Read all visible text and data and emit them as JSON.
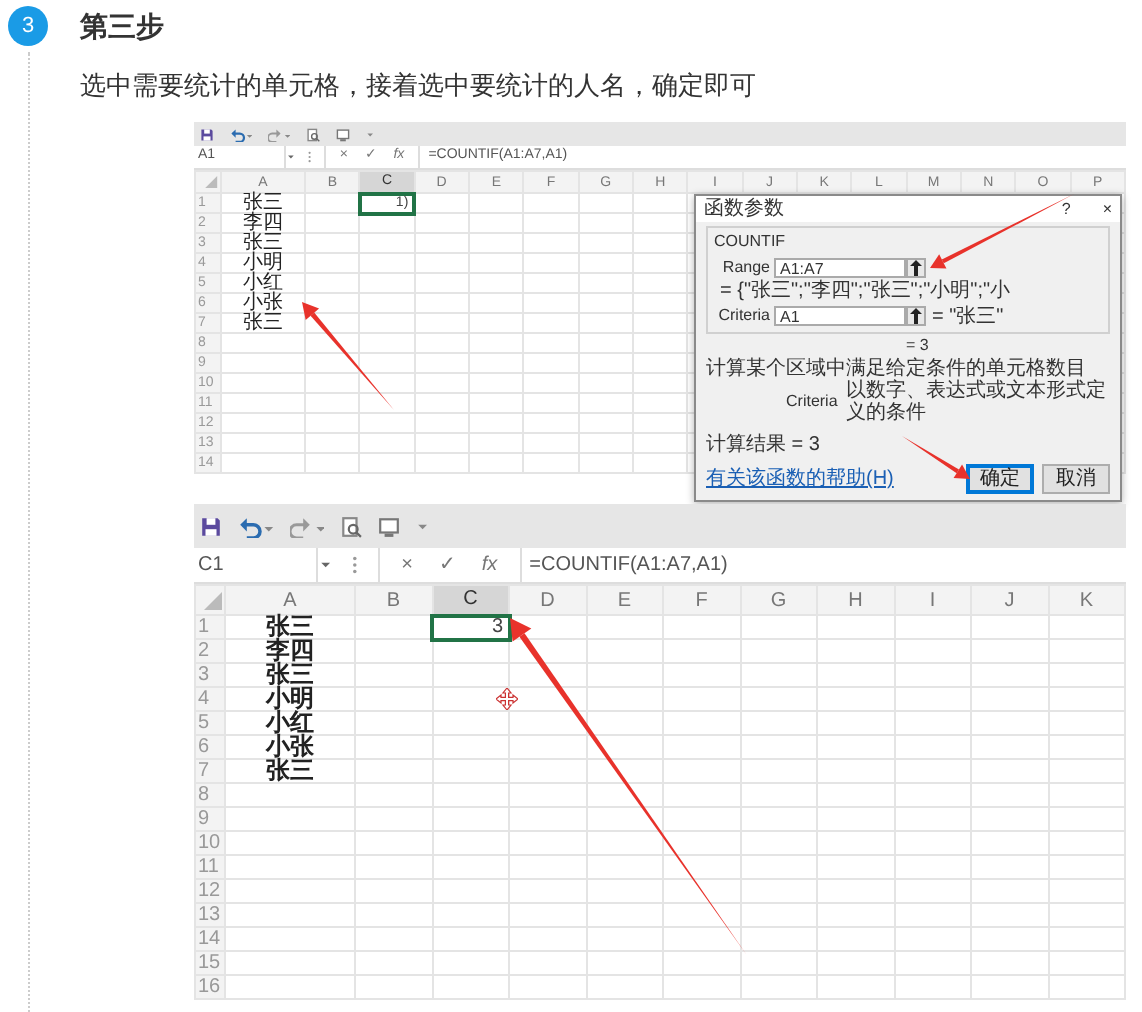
{
  "step": {
    "number": "3",
    "title": "第三步",
    "instruction": "选中需要统计的单元格，接着选中要统计的人名，确定即可"
  },
  "screenshots": [
    {
      "name_box": "A1",
      "formula_buttons": [
        "×",
        "✓",
        "fx"
      ],
      "formula": "=COUNTIF(A1:A7,A1)",
      "columns": [
        {
          "label": "A",
          "selected": false
        },
        {
          "label": "B",
          "selected": false
        },
        {
          "label": "C",
          "selected": true
        },
        {
          "label": "D",
          "selected": false
        },
        {
          "label": "E",
          "selected": false
        },
        {
          "label": "F",
          "selected": false
        },
        {
          "label": "G",
          "selected": false
        },
        {
          "label": "H",
          "selected": false
        },
        {
          "label": "I",
          "selected": false
        },
        {
          "label": "J",
          "selected": false
        },
        {
          "label": "K",
          "selected": false
        },
        {
          "label": "L",
          "selected": false
        },
        {
          "label": "M",
          "selected": false
        },
        {
          "label": "N",
          "selected": false
        },
        {
          "label": "O",
          "selected": false
        },
        {
          "label": "P",
          "selected": false
        }
      ],
      "rows": [
        {
          "number": "1",
          "column_a": "张三",
          "column_c": {
            "text": "1)",
            "selected": true
          }
        },
        {
          "number": "2",
          "column_a": "李四"
        },
        {
          "number": "3",
          "column_a": "张三"
        },
        {
          "number": "4",
          "column_a": "小明"
        },
        {
          "number": "5",
          "column_a": "小红"
        },
        {
          "number": "6",
          "column_a": "小张"
        },
        {
          "number": "7",
          "column_a": "张三"
        },
        {
          "number": "8"
        },
        {
          "number": "9"
        },
        {
          "number": "10"
        },
        {
          "number": "11"
        },
        {
          "number": "12"
        },
        {
          "number": "13"
        },
        {
          "number": "14"
        }
      ],
      "dialog": {
        "title": "函数参数",
        "help": "?",
        "close": "×",
        "function": "COUNTIF",
        "arguments": [
          {
            "label": "Range",
            "value": "A1:A7",
            "result": "= {\"张三\";\"李四\";\"张三\";\"小明\";\"小"
          },
          {
            "label": "Criteria",
            "value": "A1",
            "result": "= \"张三\""
          }
        ],
        "total": "= 3",
        "description": "计算某个区域中满足给定条件的单元格数目",
        "argument_help": {
          "label": "Criteria",
          "text": "以数字、表达式或文本形式定义的条件"
        },
        "result": "计算结果 = 3",
        "help_link": "有关该函数的帮助(H)",
        "buttons": [
          {
            "label": "确定",
            "default": true
          },
          {
            "label": "取消",
            "default": false
          }
        ]
      }
    },
    {
      "name_box": "C1",
      "formula_buttons": [
        "×",
        "✓",
        "fx"
      ],
      "formula": "=COUNTIF(A1:A7,A1)",
      "columns": [
        {
          "label": "A",
          "selected": false
        },
        {
          "label": "B",
          "selected": false
        },
        {
          "label": "C",
          "selected": true
        },
        {
          "label": "D",
          "selected": false
        },
        {
          "label": "E",
          "selected": false
        },
        {
          "label": "F",
          "selected": false
        },
        {
          "label": "G",
          "selected": false
        },
        {
          "label": "H",
          "selected": false
        },
        {
          "label": "I",
          "selected": false
        },
        {
          "label": "J",
          "selected": false
        },
        {
          "label": "K",
          "selected": false
        }
      ],
      "rows": [
        {
          "number": "1",
          "column_a": "张三",
          "column_c": {
            "text": "3",
            "selected": true
          }
        },
        {
          "number": "2",
          "column_a": "李四"
        },
        {
          "number": "3",
          "column_a": "张三"
        },
        {
          "number": "4",
          "column_a": "小明"
        },
        {
          "number": "5",
          "column_a": "小红"
        },
        {
          "number": "6",
          "column_a": "小张"
        },
        {
          "number": "7",
          "column_a": "张三"
        },
        {
          "number": "8"
        },
        {
          "number": "9"
        },
        {
          "number": "10"
        },
        {
          "number": "11"
        },
        {
          "number": "12"
        },
        {
          "number": "13"
        },
        {
          "number": "14"
        },
        {
          "number": "15"
        },
        {
          "number": "16"
        }
      ]
    }
  ]
}
